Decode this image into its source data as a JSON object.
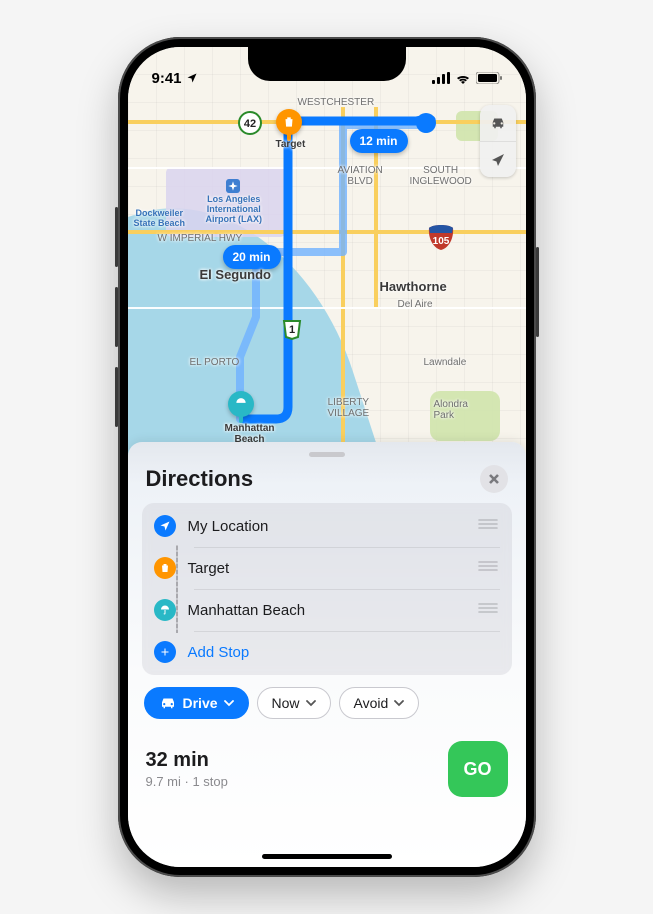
{
  "status": {
    "time": "9:41"
  },
  "map": {
    "labels": {
      "westchester": "WESTCHESTER",
      "south_inglewood": "SOUTH\nINGLEWOOD",
      "aviation": "AVIATION\nBLVD",
      "imperial": "W IMPERIAL HWY",
      "el_segundo": "El Segundo",
      "el_porto": "EL PORTO",
      "hawthorne": "Hawthorne",
      "del_aire": "Del Aire",
      "lawndale": "Lawndale",
      "liberty": "LIBERTY\nVILLAGE",
      "alondra": "Alondra\nPark",
      "dockweiler": "Dockweiler\nState Beach",
      "lax": "Los Angeles\nInternational\nAirport (LAX)"
    },
    "route_times": {
      "primary": "12 min",
      "alternate": "20 min"
    },
    "shields": {
      "hwy42": "42",
      "ca1": "1",
      "i105": "105"
    },
    "pins": {
      "target": "Target",
      "manhattan": "Manhattan\nBeach"
    }
  },
  "sheet": {
    "title": "Directions",
    "stops": [
      {
        "icon": "location",
        "color": "#0a7aff",
        "label": "My Location",
        "link": false,
        "reorder": true
      },
      {
        "icon": "bag",
        "color": "#ff9500",
        "label": "Target",
        "link": false,
        "reorder": true
      },
      {
        "icon": "umbrella",
        "color": "#29b8c6",
        "label": "Manhattan Beach",
        "link": false,
        "reorder": true
      },
      {
        "icon": "plus",
        "color": "#0a7aff",
        "label": "Add Stop",
        "link": true,
        "reorder": false
      }
    ],
    "chips": {
      "mode": "Drive",
      "when": "Now",
      "avoid": "Avoid"
    },
    "summary": {
      "time": "32 min",
      "meta": "9.7 mi · 1 stop",
      "go": "GO"
    }
  }
}
